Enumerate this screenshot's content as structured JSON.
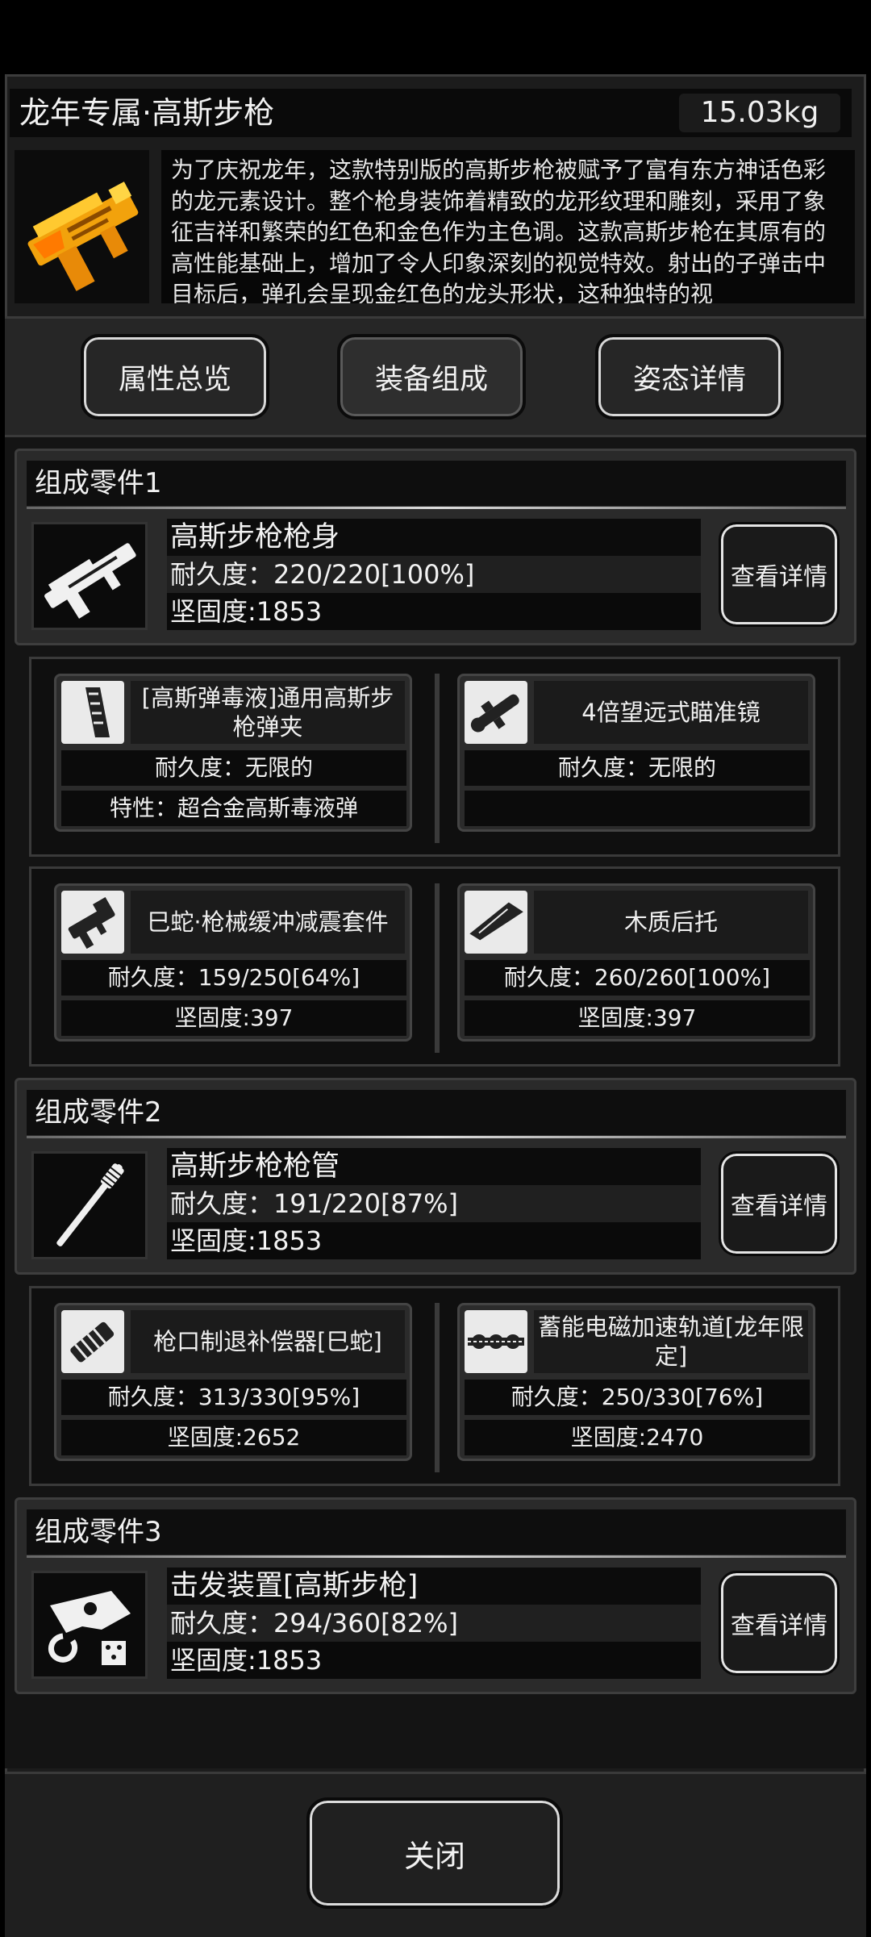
{
  "header": {
    "title": "龙年专属·高斯步枪",
    "weight": "15.03kg",
    "description": "为了庆祝龙年，这款特别版的高斯步枪被赋予了富有东方神话色彩的龙元素设计。整个枪身装饰着精致的龙形纹理和雕刻，采用了象征吉祥和繁荣的红色和金色作为主色调。这款高斯步枪在其原有的高性能基础上，增加了令人印象深刻的视觉特效。射出的子弹击中目标后，弹孔会呈现金红色的龙头形状，这种独特的视"
  },
  "tabs": [
    {
      "label": "属性总览"
    },
    {
      "label": "装备组成"
    },
    {
      "label": "姿态详情"
    }
  ],
  "sections": [
    {
      "title": "组成零件1",
      "part": {
        "name": "高斯步枪枪身",
        "durability": "耐久度：220/220[100%]",
        "hardness": "坚固度:1853",
        "icon": "rifle-body-icon"
      },
      "detail_label": "查看详情",
      "cards": [
        {
          "name": "[高斯弹毒液]通用高斯步枪弹夹",
          "row1": "耐久度：无限的",
          "row2": "特性：超合金高斯毒液弹",
          "icon": "magazine-icon"
        },
        {
          "name": "4倍望远式瞄准镜",
          "row1": "耐久度：无限的",
          "row2": "",
          "icon": "scope-icon"
        },
        {
          "name": "巳蛇·枪械缓冲减震套件",
          "row1": "耐久度：159/250[64%]",
          "row2": "坚固度:397",
          "icon": "recoil-kit-icon"
        },
        {
          "name": "木质后托",
          "row1": "耐久度：260/260[100%]",
          "row2": "坚固度:397",
          "icon": "stock-icon"
        }
      ]
    },
    {
      "title": "组成零件2",
      "part": {
        "name": "高斯步枪枪管",
        "durability": "耐久度：191/220[87%]",
        "hardness": "坚固度:1853",
        "icon": "barrel-icon"
      },
      "detail_label": "查看详情",
      "cards": [
        {
          "name": "枪口制退补偿器[巳蛇]",
          "row1": "耐久度：313/330[95%]",
          "row2": "坚固度:2652",
          "icon": "muzzle-brake-icon"
        },
        {
          "name": "蓄能电磁加速轨道[龙年限定]",
          "row1": "耐久度：250/330[76%]",
          "row2": "坚固度:2470",
          "icon": "rail-icon"
        }
      ]
    },
    {
      "title": "组成零件3",
      "part": {
        "name": "击发装置[高斯步枪]",
        "durability": "耐久度：294/360[82%]",
        "hardness": "坚固度:1853",
        "icon": "trigger-icon"
      },
      "detail_label": "查看详情"
    }
  ],
  "footer": {
    "close_label": "关闭"
  }
}
